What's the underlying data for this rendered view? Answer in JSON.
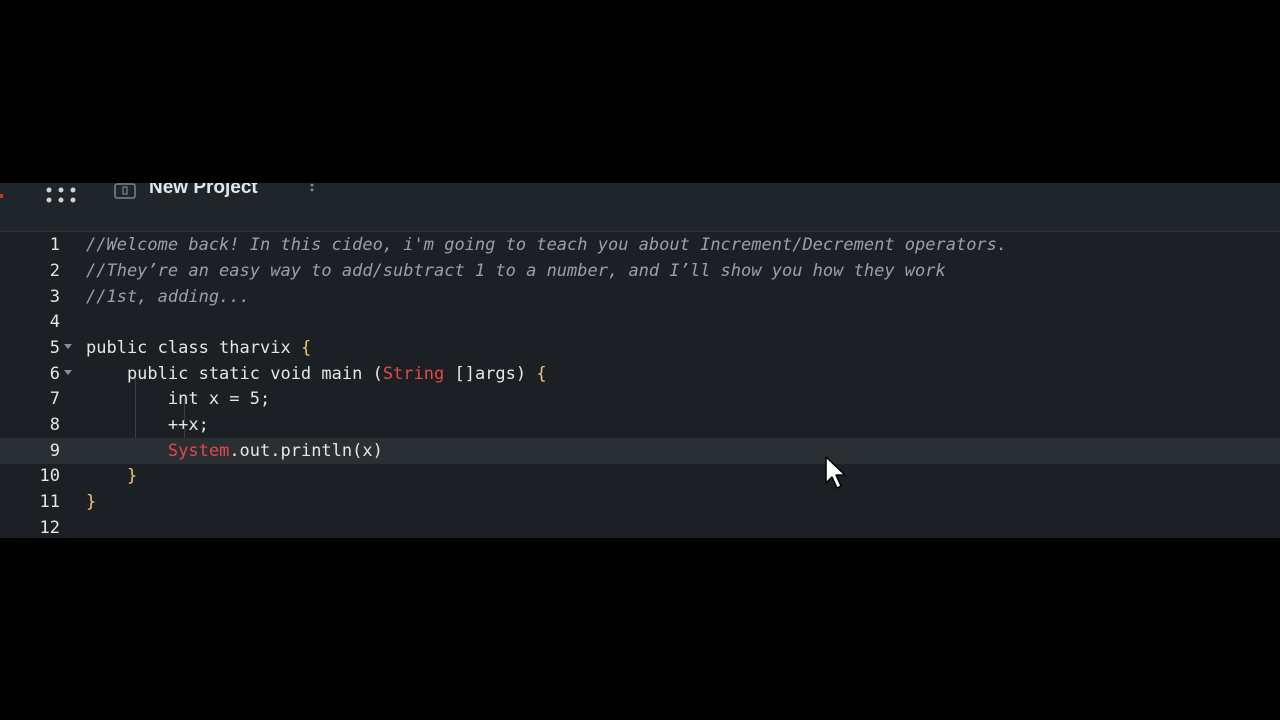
{
  "topbar": {
    "project_title": "New Project",
    "icons": [
      "apps-grid-icon",
      "project-icon",
      "kebab-menu-icon"
    ]
  },
  "editor": {
    "lines": [
      {
        "num": "1",
        "text": "//Welcome back! In this cideo, i'm going to teach you about Increment/Decrement operators."
      },
      {
        "num": "2",
        "text": "//They’re an easy way to add/subtract 1 to a number, and I’ll show you how they work"
      },
      {
        "num": "3",
        "text": "//1st, adding..."
      },
      {
        "num": "4",
        "text": ""
      },
      {
        "num": "5",
        "text": "public class tharvix {"
      },
      {
        "num": "6",
        "text": "    public static void main (String []args) {"
      },
      {
        "num": "7",
        "text": "        int x = 5;"
      },
      {
        "num": "8",
        "text": "        ++x;"
      },
      {
        "num": "9",
        "text": "        System.out.println(x)"
      },
      {
        "num": "10",
        "text": "    }"
      },
      {
        "num": "11",
        "text": "}"
      },
      {
        "num": "12",
        "text": ""
      }
    ],
    "active_line": 9
  },
  "colors": {
    "background": "#000000",
    "editor_bg": "#1c2024",
    "comment": "#9aa0a6",
    "class_ref": "#e34948",
    "brace": "#f0c674"
  }
}
